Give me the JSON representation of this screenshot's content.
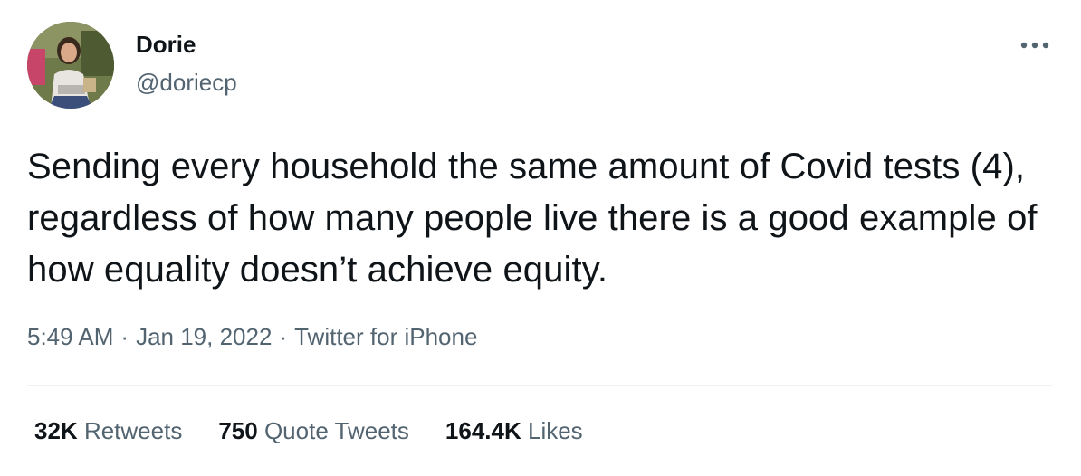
{
  "author": {
    "name": "Dorie",
    "handle": "@doriecp",
    "avatar_icon": "user-avatar-photo"
  },
  "more_icon": "more-dots-icon",
  "tweet": {
    "text": "Sending every household the same amount of Covid tests (4), regardless of how many people live there is a good example of how equality doesn’t achieve equity."
  },
  "meta": {
    "time": "5:49 AM",
    "date": "Jan 19, 2022",
    "source": "Twitter for iPhone",
    "separator": "·"
  },
  "stats": {
    "retweets": {
      "count": "32K",
      "label": "Retweets"
    },
    "quotes": {
      "count": "750",
      "label": "Quote Tweets"
    },
    "likes": {
      "count": "164.4K",
      "label": "Likes"
    }
  },
  "colors": {
    "primary_text": "#0f1419",
    "secondary_text": "#536471",
    "divider": "#eff3f4"
  }
}
